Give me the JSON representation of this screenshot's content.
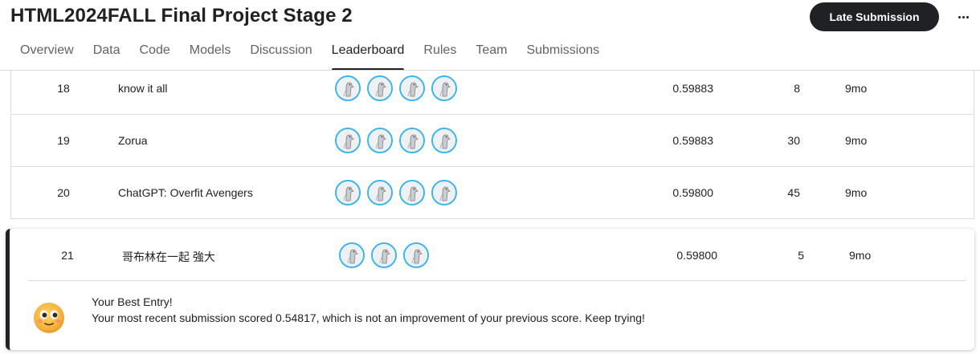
{
  "header": {
    "title": "HTML2024FALL Final Project Stage 2",
    "late_submission_label": "Late Submission",
    "more_icon": "more-horizontal-icon"
  },
  "tabs": [
    {
      "label": "Overview",
      "active": false
    },
    {
      "label": "Data",
      "active": false
    },
    {
      "label": "Code",
      "active": false
    },
    {
      "label": "Models",
      "active": false
    },
    {
      "label": "Discussion",
      "active": false
    },
    {
      "label": "Leaderboard",
      "active": true
    },
    {
      "label": "Rules",
      "active": false
    },
    {
      "label": "Team",
      "active": false
    },
    {
      "label": "Submissions",
      "active": false
    }
  ],
  "leaderboard": {
    "rows": [
      {
        "rank": "18",
        "team": "know it all",
        "members": 4,
        "score": "0.59883",
        "entries": "8",
        "last": "9mo"
      },
      {
        "rank": "19",
        "team": "Zorua",
        "members": 4,
        "score": "0.59883",
        "entries": "30",
        "last": "9mo"
      },
      {
        "rank": "20",
        "team": "ChatGPT: Overfit Avengers",
        "members": 4,
        "score": "0.59800",
        "entries": "45",
        "last": "9mo"
      }
    ]
  },
  "my_entry": {
    "rank": "21",
    "team": "哥布林在一起 強大",
    "members": 3,
    "score": "0.59800",
    "entries": "5",
    "last": "9mo",
    "best_entry_title": "Your Best Entry!",
    "best_entry_message": "Your most recent submission scored 0.54817, which is not an improvement of your previous score. Keep trying!",
    "emoji_icon": "smiling-face-emoji-icon"
  },
  "colors": {
    "avatar_ring": "#3ab5f0",
    "button_bg": "#202124",
    "divider": "#dadce0"
  }
}
